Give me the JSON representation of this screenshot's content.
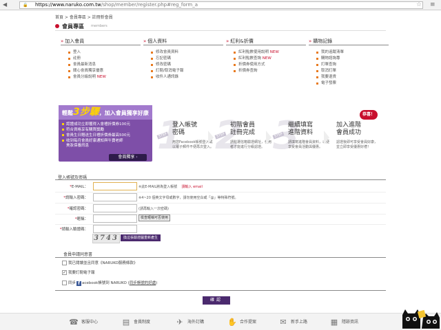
{
  "browser": {
    "url_host": "https://www.naruko.com.tw",
    "url_path": "/shop/member/register.php#reg_form_a"
  },
  "breadcrumb": "首頁 > 會員專區 > 註冊新會員",
  "section": {
    "title": "會員專區",
    "subtitle": "members"
  },
  "menu": {
    "columns": [
      {
        "title": "加入會員",
        "items": [
          {
            "label": "登入",
            "new": ""
          },
          {
            "label": "註冊",
            "new": ""
          },
          {
            "label": "會員最新消息",
            "new": ""
          },
          {
            "label": "關心會員獨享優惠",
            "new": ""
          },
          {
            "label": "會員分級說明",
            "new": "NEW"
          }
        ]
      },
      {
        "title": "個人資料",
        "items": [
          {
            "label": "修改會員資料",
            "new": ""
          },
          {
            "label": "忘記密碼",
            "new": ""
          },
          {
            "label": "修改密碼",
            "new": ""
          },
          {
            "label": "訂閱/取消電子報",
            "new": ""
          },
          {
            "label": "收件人通訊錄",
            "new": ""
          }
        ]
      },
      {
        "title": "紅利&折價",
        "items": [
          {
            "label": "紅利點數使用說明",
            "new": "NEW"
          },
          {
            "label": "紅利點數查詢",
            "new": "NEW"
          },
          {
            "label": "折價券使用方式",
            "new": ""
          },
          {
            "label": "折價券查詢",
            "new": ""
          }
        ]
      },
      {
        "title": "購物記錄",
        "items": [
          {
            "label": "我的追蹤清單",
            "new": ""
          },
          {
            "label": "購物諮詢專",
            "new": ""
          },
          {
            "label": "訂單查詢",
            "new": ""
          },
          {
            "label": "取消訂單",
            "new": ""
          },
          {
            "label": "我要退貨",
            "new": ""
          },
          {
            "label": "電子發票",
            "new": ""
          }
        ]
      }
    ]
  },
  "promo": {
    "pre": "輕鬆",
    "big": "3步驟",
    "post": "，加入會員獨享好康",
    "lines": [
      "認證成功立即獲得入會禮折價券100元",
      "符合資格享有購買獎勵",
      "會員生日贈送生日禮折價券最高500元",
      "收到每月會員好康通知與牛寶老師",
      "美妝保養訊息"
    ],
    "button": "會員獨享"
  },
  "steps": [
    {
      "num": "1",
      "tag": "STEP",
      "title1": "登入帳號",
      "title2": "密碼",
      "desc": "用您Facebook帳號登入或以電子郵件不便再次登入。"
    },
    {
      "num": "2",
      "tag": "STEP",
      "title1": "初階會員",
      "title2": "註冊完成",
      "desc": "請點選信箱驗證網址，使用者才能進行分級認證。"
    },
    {
      "num": "3",
      "tag": "STEP",
      "title1": "繼續填寫",
      "title2": "進階資料",
      "desc": "請填寫進階會員資料，以便享受會員活動與優惠。"
    },
    {
      "num": "",
      "tag": "",
      "title1": "加入進階",
      "title2": "會員成功",
      "desc": "認證後即可享受會員好康，並立即享受優惠好禮！"
    }
  ],
  "congrats": "恭喜！",
  "form": {
    "title": "登入帳號及密碼",
    "email_label": "E-MAIL：",
    "email_hint": "※此E-MAIL將為登入帳號",
    "email_hint_red": "請輸入 email",
    "password_label": "請輸入密碼：",
    "password_hint": "※4~20 個英文字母或數字，請勿使用空白或「@」等特殊符號。",
    "confirm_label": "確認密碼：",
    "confirm_hint": "(請再輸入一次密碼)",
    "nickname_label": "暱稱：",
    "nickname_button": "檢查暱稱可否使用",
    "captcha_label": "請輸入驗證碼：",
    "captcha_text": "3743",
    "captcha_refresh": "換這張驗證圖重新產生"
  },
  "agreement": {
    "title": "會員申請同意書",
    "items": [
      {
        "checked": false,
        "label": "我已閱讀並且同意《NARUKO服務條款》"
      },
      {
        "checked": true,
        "label": "我要訂閱電子報"
      }
    ],
    "facebook_pre": "同步",
    "facebook_mid": "acebook帳號到 NARUKO (",
    "facebook_link": "同步帳號的好處",
    "facebook_post": ")"
  },
  "submit": "確認",
  "footer": [
    {
      "icon": "phone-icon",
      "glyph": "☎",
      "label": "客服中心"
    },
    {
      "icon": "member-card-icon",
      "glyph": "▤",
      "label": "會員制度"
    },
    {
      "icon": "plane-icon",
      "glyph": "✈",
      "label": "海外訂購"
    },
    {
      "icon": "handshake-icon",
      "glyph": "✋",
      "label": "合作提案"
    },
    {
      "icon": "chat-icon",
      "glyph": "✉",
      "label": "新手上路"
    },
    {
      "icon": "document-icon",
      "glyph": "▦",
      "label": "隱跡資訊"
    }
  ],
  "colors": {
    "brand_red": "#c8102e",
    "brand_purple": "#7e4fa8",
    "dark_purple": "#4b2a6e",
    "bullet_orange": "#e87a1e"
  }
}
